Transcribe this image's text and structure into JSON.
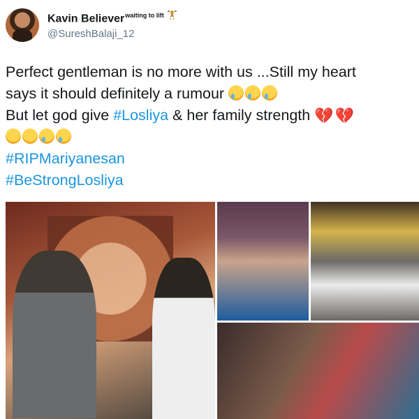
{
  "header": {
    "display_name": "Kavin Believer",
    "name_suffix": "waiting to lift",
    "handle": "@SureshBalaji_12"
  },
  "tweet": {
    "line1": "Perfect gentleman is no more with us ...Still my heart",
    "line2": "says it should definitely a rumour",
    "line3_prefix": "But let god give ",
    "line3_tag": "#Losliya",
    "line3_suffix": " & her family strength",
    "hashtag1": "#RIPMariyanesan",
    "hashtag2": "#BeStrongLosliya"
  },
  "icons": {
    "emoji_cry": "crying-face-icon",
    "emoji_pensive": "pensive-face-icon",
    "emoji_heart": "broken-heart-icon",
    "emoji_lift": "weight-lifter-icon"
  },
  "colors": {
    "link": "#1b95e0",
    "heart": "#d8143a",
    "handle": "#657786"
  }
}
